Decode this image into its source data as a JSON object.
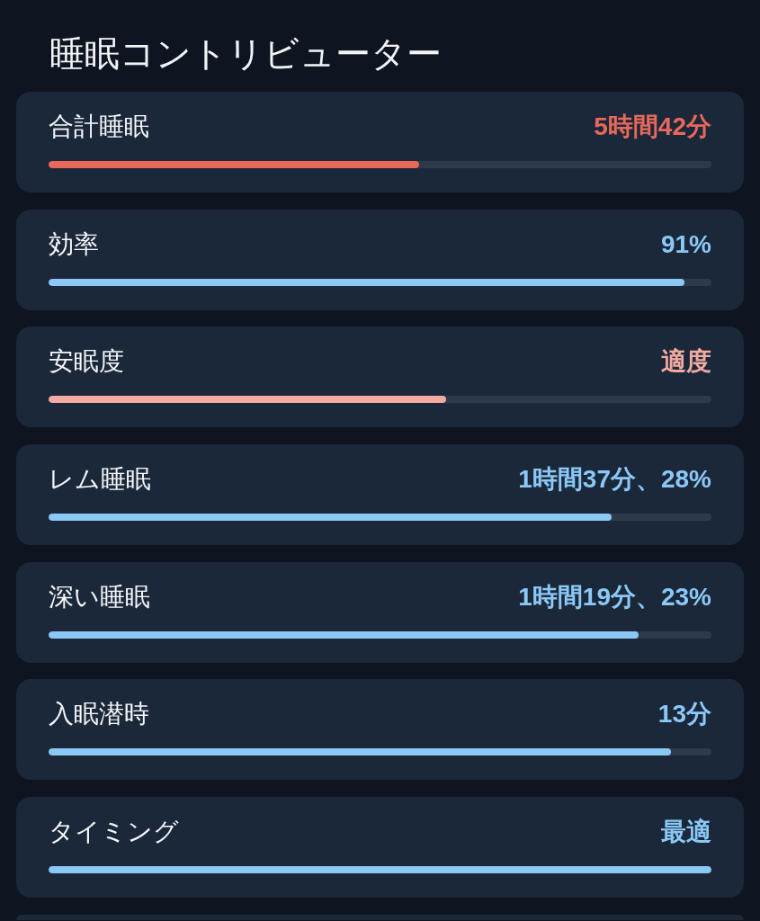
{
  "title": "睡眠コントリビューター",
  "contributors": [
    {
      "label": "合計睡眠",
      "value": "5時間42分",
      "level": 0.559,
      "color": "#e8695b"
    },
    {
      "label": "効率",
      "value": "91%",
      "level": 0.959,
      "color": "#8cc8f6"
    },
    {
      "label": "安眠度",
      "value": "適度",
      "level": 0.6,
      "color": "#f2aaa2"
    },
    {
      "label": "レム睡眠",
      "value": "1時間37分、28%",
      "level": 0.849,
      "color": "#8cc8f6"
    },
    {
      "label": "深い睡眠",
      "value": "1時間19分、23%",
      "level": 0.89,
      "color": "#8cc8f6"
    },
    {
      "label": "入眠潜時",
      "value": "13分",
      "level": 0.939,
      "color": "#8cc8f6"
    },
    {
      "label": "タイミング",
      "value": "最適",
      "level": 1.0,
      "color": "#8cc8f6"
    }
  ],
  "next_card_cut_off": true
}
